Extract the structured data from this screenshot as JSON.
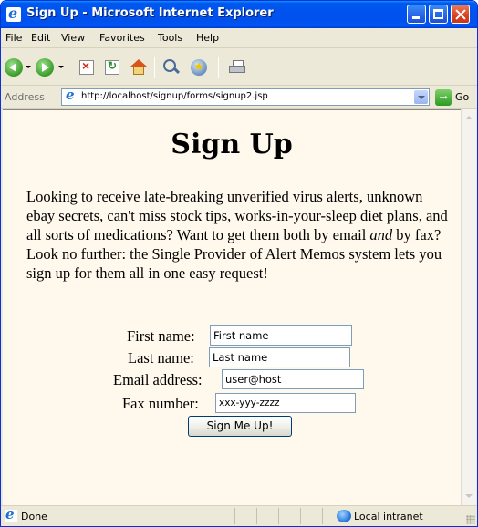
{
  "window": {
    "title": "Sign Up - Microsoft Internet Explorer"
  },
  "menu": {
    "items": [
      "File",
      "Edit",
      "View",
      "Favorites",
      "Tools",
      "Help"
    ]
  },
  "address": {
    "label": "Address",
    "url": "http://localhost/signup/forms/signup2.jsp",
    "go_label": "Go"
  },
  "page": {
    "title": "Sign Up",
    "intro_before": "Looking to receive late-breaking unverified virus alerts, unknown ebay secrets, can't miss stock tips, works-in-your-sleep diet plans, and all sorts of medications? Want to get them both by email ",
    "intro_em": "and",
    "intro_after": " by fax? Look no further: the Single Provider of Alert Memos system lets you sign up for them all in one easy request!",
    "form": {
      "first_name_label": "First name:",
      "first_name_value": "First name",
      "last_name_label": "Last name:",
      "last_name_value": "Last name",
      "email_label": "Email address:",
      "email_value": "user@host",
      "fax_label": "Fax number:",
      "fax_value": "xxx-yyy-zzzz",
      "submit_label": "Sign Me Up!"
    }
  },
  "status": {
    "text": "Done",
    "zone": "Local intranet"
  }
}
